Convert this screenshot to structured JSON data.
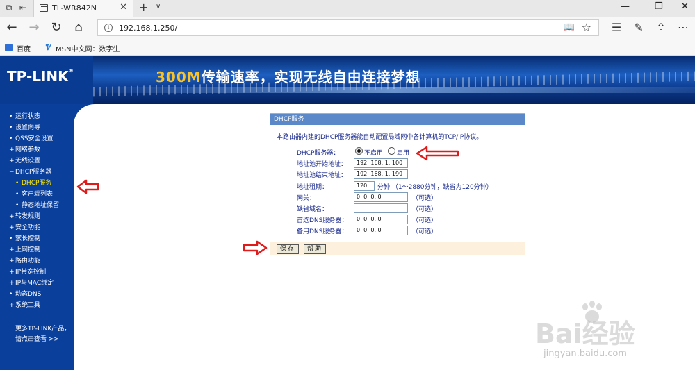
{
  "browser": {
    "tab_title": "TL-WR842N",
    "url": "192.168.1.250/",
    "favorites": [
      {
        "label": "百度"
      },
      {
        "label": "MSN中文网：数字生"
      }
    ]
  },
  "banner": {
    "logo": "TP-LINK",
    "logo_reg": "®",
    "slogan_highlight": "300M",
    "slogan_rest": "传输速率，实现无线自由连接梦想"
  },
  "sidebar": {
    "items": [
      {
        "label": "运行状态",
        "bullet": "•"
      },
      {
        "label": "设置向导",
        "bullet": "•"
      },
      {
        "label": "QSS安全设置",
        "bullet": "•"
      },
      {
        "label": "网络参数",
        "bullet": "+"
      },
      {
        "label": "无线设置",
        "bullet": "+"
      },
      {
        "label": "DHCP服务器",
        "bullet": "−"
      },
      {
        "label": "DHCP服务",
        "bullet": "•"
      },
      {
        "label": "客户端列表",
        "bullet": "•"
      },
      {
        "label": "静态地址保留",
        "bullet": "•"
      },
      {
        "label": "转发规则",
        "bullet": "+"
      },
      {
        "label": "安全功能",
        "bullet": "+"
      },
      {
        "label": "家长控制",
        "bullet": "•"
      },
      {
        "label": "上网控制",
        "bullet": "+"
      },
      {
        "label": "路由功能",
        "bullet": "+"
      },
      {
        "label": "IP带宽控制",
        "bullet": "+"
      },
      {
        "label": "IP与MAC绑定",
        "bullet": "+"
      },
      {
        "label": "动态DNS",
        "bullet": "•"
      },
      {
        "label": "系统工具",
        "bullet": "+"
      }
    ],
    "more_line1": "更多TP-LINK产品，",
    "more_line2": "请点击查看 >>"
  },
  "dhcp": {
    "title": "DHCP服务",
    "description": "本路由器内建的DHCP服务器能自动配置局域网中各计算机的TCP/IP协议。",
    "server_label": "DHCP服务器：",
    "radio_off": "不启用",
    "radio_on": "启用",
    "start_label": "地址池开始地址：",
    "start_value": "192. 168. 1. 100",
    "end_label": "地址池结束地址：",
    "end_value": "192. 168. 1. 199",
    "lease_label": "地址租期：",
    "lease_value": "120",
    "lease_hint": "分钟 （1～2880分钟，缺省为120分钟）",
    "gateway_label": "网关：",
    "gateway_value": "0. 0. 0. 0",
    "gateway_hint": "（可选）",
    "domain_label": "缺省域名：",
    "domain_value": "",
    "domain_hint": "（可选）",
    "dns1_label": "首选DNS服务器：",
    "dns1_value": "0. 0. 0. 0",
    "dns1_hint": "（可选）",
    "dns2_label": "备用DNS服务器：",
    "dns2_value": "0. 0. 0. 0",
    "dns2_hint": "（可选）",
    "save_label": "保存",
    "help_label": "帮助"
  },
  "watermark": {
    "brand": "Bai经验",
    "url": "jingyan.baidu.com"
  },
  "colors": {
    "sidebar_bg": "#0a3f9c",
    "active_menu": "#ffea00",
    "panel_border": "#f1a23a",
    "panel_header": "#5b88c9",
    "annotation_red": "#e01b1b"
  }
}
